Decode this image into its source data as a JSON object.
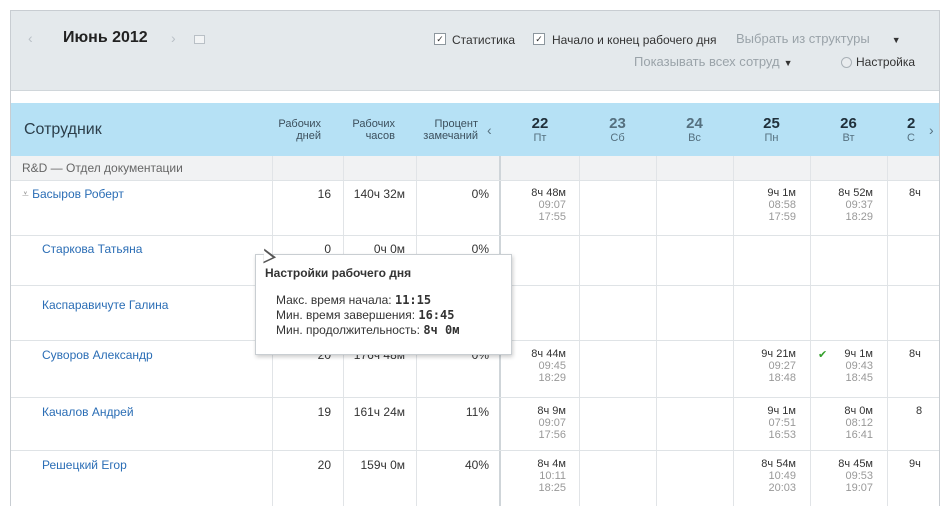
{
  "header": {
    "prev": "‹",
    "month": "Июнь 2012",
    "next": "›",
    "stats_label": "Статистика",
    "workday_label": "Начало и конец рабочего дня",
    "structure_select": "Выбрать из структуры",
    "employees_select": "Показывать всех сотруд",
    "settings_label": "Настройка"
  },
  "columns": {
    "employee": "Сотрудник",
    "work_days": [
      "Рабочих",
      "дней"
    ],
    "work_hours": [
      "Рабочих",
      "часов"
    ],
    "remarks_pct": [
      "Процент",
      "замечаний"
    ],
    "scroll_left": "‹",
    "scroll_right": "›",
    "days": [
      {
        "num": "22",
        "name": "Пт"
      },
      {
        "num": "23",
        "name": "Сб"
      },
      {
        "num": "24",
        "name": "Вс"
      },
      {
        "num": "25",
        "name": "Пн"
      },
      {
        "num": "26",
        "name": "Вт"
      },
      {
        "num": "2",
        "name": "С"
      }
    ]
  },
  "group": "R&D  —  Отдел документации",
  "rows": [
    {
      "name": "Басыров Роберт",
      "days": "16",
      "hours": "140ч 32м",
      "pct": "0%",
      "d22": [
        "8ч 48м",
        "09:07",
        "17:55"
      ],
      "d25": [
        "9ч 1м",
        "08:58",
        "17:59"
      ],
      "d26": [
        "8ч 52м",
        "09:37",
        "18:29"
      ],
      "d27": "8ч"
    },
    {
      "name": "Старкова Татьяна",
      "days": "0",
      "hours": "0ч 0м",
      "pct": "0%"
    },
    {
      "name": "Каспаравичуте Галина"
    },
    {
      "name": "Суворов Александр",
      "days": "20",
      "hours": "176ч 48м",
      "pct": "0%",
      "d22": [
        "8ч 44м",
        "09:45",
        "18:29"
      ],
      "d25": [
        "9ч 21м",
        "09:27",
        "18:48"
      ],
      "d26": [
        "9ч 1м",
        "09:43",
        "18:45"
      ],
      "d27": "8ч"
    },
    {
      "name": "Качалов Андрей",
      "days": "19",
      "hours": "161ч 24м",
      "pct": "11%",
      "d22": [
        "8ч 9м",
        "09:07",
        "17:56"
      ],
      "d25": [
        "9ч 1м",
        "07:51",
        "16:53"
      ],
      "d26": [
        "8ч 0м",
        "08:12",
        "16:41"
      ],
      "d27": "8"
    },
    {
      "name": "Решецкий Егор",
      "days": "20",
      "hours": "159ч 0м",
      "pct": "40%",
      "d22": [
        "8ч 4м",
        "10:11",
        "18:25"
      ],
      "d25": [
        "8ч 54м",
        "10:49",
        "20:03"
      ],
      "d26": [
        "8ч 45м",
        "09:53",
        "19:07"
      ],
      "d27": "9ч"
    }
  ],
  "tooltip": {
    "title": "Настройки рабочего дня",
    "start_label": "Макс. время начала: ",
    "start_value": "11:15",
    "end_label": "Мин. время завершения: ",
    "end_value": "16:45",
    "dur_label": "Мин. продолжительность: ",
    "dur_value": "8ч 0м"
  }
}
